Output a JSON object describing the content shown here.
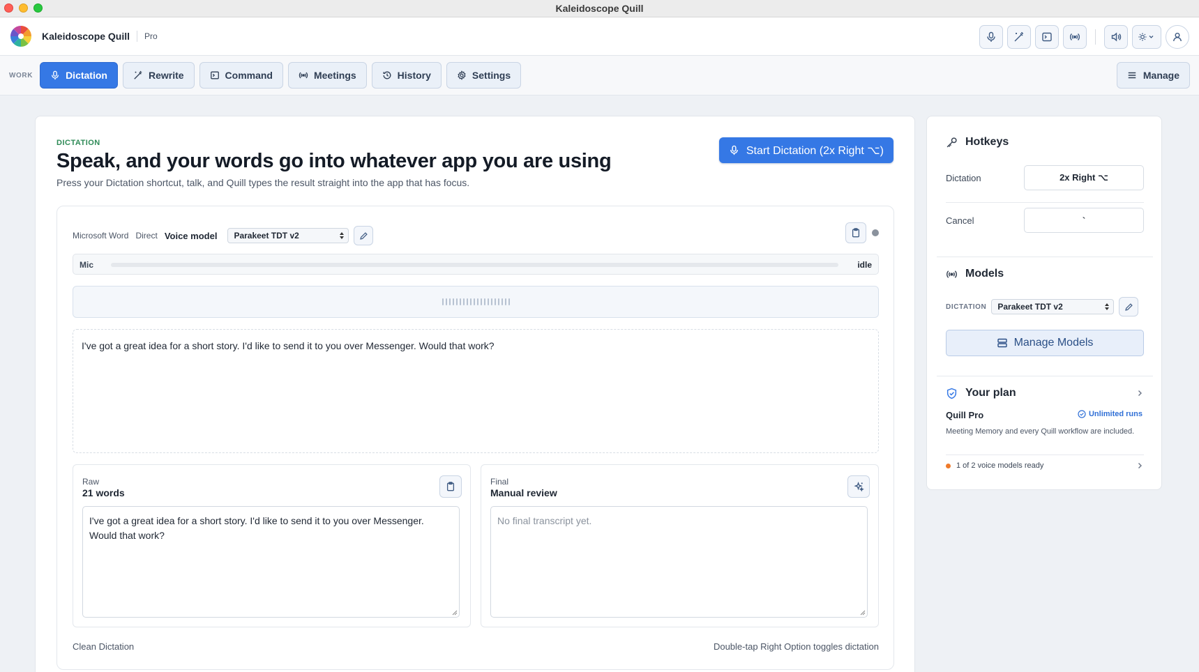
{
  "window": {
    "title": "Kaleidoscope Quill"
  },
  "header": {
    "brand": "Kaleidoscope Quill",
    "plan_tag": "Pro",
    "icons": [
      "mic-icon",
      "wand-icon",
      "terminal-icon",
      "broadcast-icon",
      "speaker-icon",
      "theme-icon",
      "user-icon"
    ]
  },
  "nav": {
    "section_label": "WORK",
    "tabs": [
      {
        "label": "Dictation",
        "icon": "mic-icon",
        "active": true
      },
      {
        "label": "Rewrite",
        "icon": "wand-icon"
      },
      {
        "label": "Command",
        "icon": "terminal-icon"
      },
      {
        "label": "Meetings",
        "icon": "broadcast-icon"
      },
      {
        "label": "History",
        "icon": "history-icon"
      },
      {
        "label": "Settings",
        "icon": "gear-icon"
      }
    ],
    "manage_label": "Manage"
  },
  "main": {
    "eyebrow": "DICTATION",
    "headline": "Speak, and your words go into whatever app you are using",
    "subline": "Press your Dictation shortcut, talk, and Quill types the result straight into the app that has focus.",
    "start_button": "Start Dictation (2x Right ⌥)",
    "context": {
      "app": "Microsoft Word",
      "mode": "Direct",
      "voice_model_label": "Voice model",
      "voice_model_value": "Parakeet TDT v2"
    },
    "mic": {
      "label": "Mic",
      "state": "idle",
      "level": 0
    },
    "transcript": "I've got a great idea for a short story. I'd like to send it to you over Messenger. Would that work?",
    "raw": {
      "label": "Raw",
      "title": "21 words",
      "text": "I've got a great idea for a short story. I'd like to send it to you over Messenger. Would that work?"
    },
    "final": {
      "label": "Final",
      "title": "Manual review",
      "placeholder": "No final transcript yet."
    },
    "footer_left": "Clean Dictation",
    "footer_right": "Double-tap Right Option toggles dictation"
  },
  "sidebar": {
    "hotkeys": {
      "title": "Hotkeys",
      "rows": [
        {
          "label": "Dictation",
          "key": "2x Right ⌥"
        },
        {
          "label": "Cancel",
          "key": "`"
        }
      ]
    },
    "models": {
      "title": "Models",
      "dictation_label": "DICTATION",
      "dictation_value": "Parakeet TDT v2",
      "manage_label": "Manage Models"
    },
    "plan": {
      "title": "Your plan",
      "name": "Quill Pro",
      "badge": "Unlimited runs",
      "description": "Meeting Memory and every Quill workflow are included.",
      "status": "1 of 2 voice models ready"
    }
  },
  "colors": {
    "accent": "#3578e5",
    "eyebrow": "#2e8b57",
    "warning_dot": "#ef7a2a",
    "idle_dot": "#8a929d"
  }
}
